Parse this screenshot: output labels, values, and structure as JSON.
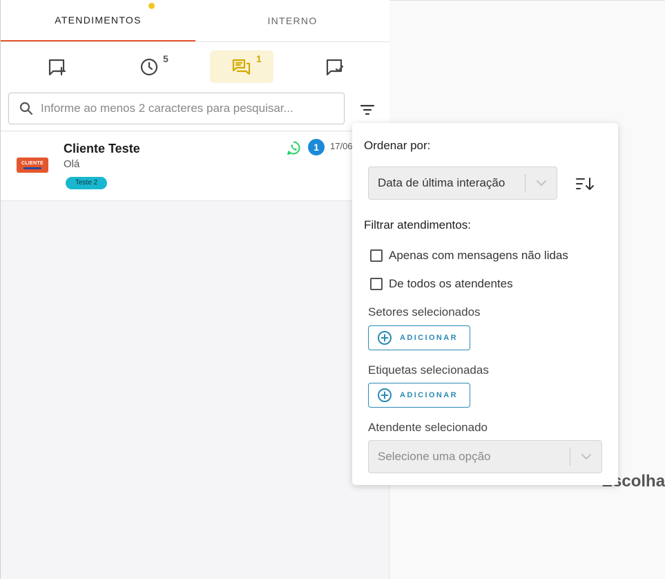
{
  "tabs": [
    {
      "label": "ATENDIMENTOS",
      "active": true
    },
    {
      "label": "INTERNO",
      "active": false
    }
  ],
  "colors": {
    "accent": "#e4572e",
    "dot": "#f3c623",
    "active_icon": "#d4a800",
    "link": "#2a8ab5",
    "badge": "#1d8ad8",
    "tag": "#19b7cf",
    "whatsapp": "#25d366"
  },
  "icon_filters": [
    {
      "icon": "chat-plus-icon",
      "count": ""
    },
    {
      "icon": "clock-icon",
      "count": "5"
    },
    {
      "icon": "chats-icon",
      "count": "1",
      "active": true
    },
    {
      "icon": "chat-check-icon",
      "count": ""
    }
  ],
  "search": {
    "placeholder": "Informe ao menos 2 caracteres para pesquisar..."
  },
  "tickets": [
    {
      "avatar_text": "CLIENTE",
      "name": "Cliente Teste",
      "last_message": "Olá",
      "tag": "Teste 2",
      "channel_icon": "whatsapp-icon",
      "unread": "1",
      "date": "17/06"
    }
  ],
  "filter_panel": {
    "order_heading": "Ordenar por:",
    "order_value": "Data de última interação",
    "filter_heading": "Filtrar atendimentos:",
    "checkboxes": [
      {
        "label": "Apenas com mensagens não lidas",
        "checked": false
      },
      {
        "label": "De todos os atendentes",
        "checked": false
      }
    ],
    "sectors_label": "Setores selecionados",
    "tags_label": "Etiquetas selecionadas",
    "add_label": "ADICIONAR",
    "attendant_label": "Atendente selecionado",
    "attendant_placeholder": "Selecione uma opção"
  },
  "main": {
    "placeholder_text": "Escolha"
  }
}
